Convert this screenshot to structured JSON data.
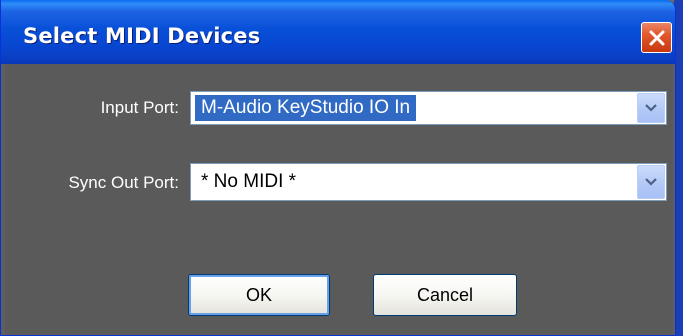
{
  "window": {
    "title": "Select MIDI Devices"
  },
  "form": {
    "input_port": {
      "label": "Input Port:",
      "value": "M-Audio KeyStudio IO In"
    },
    "sync_out_port": {
      "label": "Sync Out Port:",
      "value": "* No MIDI *"
    }
  },
  "buttons": {
    "ok_label": "OK",
    "cancel_label": "Cancel"
  },
  "icons": {
    "close": "close-icon",
    "dropdown": "chevron-down-icon"
  },
  "colors": {
    "title_bar": "#0850d8",
    "selection": "#316ac5",
    "close_button": "#e2582c",
    "dialog_body": "#5a5a5a"
  }
}
